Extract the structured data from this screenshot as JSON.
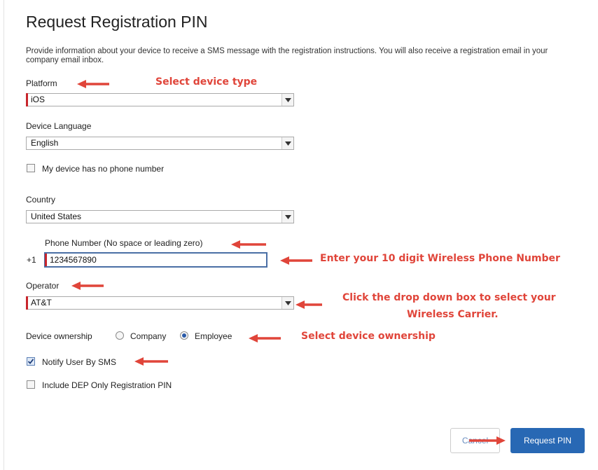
{
  "title": "Request Registration PIN",
  "intro": "Provide information about your device to receive a SMS message with the registration instructions. You will also receive a registration email in your company email inbox.",
  "fields": {
    "platform_label": "Platform",
    "platform_value": "iOS",
    "language_label": "Device Language",
    "language_value": "English",
    "no_phone_label": "My device has no phone number",
    "no_phone_checked": false,
    "country_label": "Country",
    "country_value": "United States",
    "phone_label": "Phone Number (No space or leading zero)",
    "phone_prefix": "+1",
    "phone_value": "1234567890",
    "operator_label": "Operator",
    "operator_value": "AT&T",
    "ownership_label": "Device ownership",
    "ownership_options": [
      "Company",
      "Employee"
    ],
    "ownership_selected": "Employee",
    "notify_label": "Notify User By SMS",
    "notify_checked": true,
    "dep_label": "Include DEP Only Registration PIN",
    "dep_checked": false
  },
  "annotations": {
    "device_type": "Select device type",
    "phone": "Enter your 10 digit Wireless Phone Number",
    "carrier_line1": "Click the drop down box to select your",
    "carrier_line2": "Wireless Carrier.",
    "ownership": "Select device ownership"
  },
  "buttons": {
    "cancel": "Cancel",
    "request": "Request PIN"
  },
  "colors": {
    "annotation": "#e0453a",
    "primary": "#2868b4",
    "required": "#c8252c"
  }
}
